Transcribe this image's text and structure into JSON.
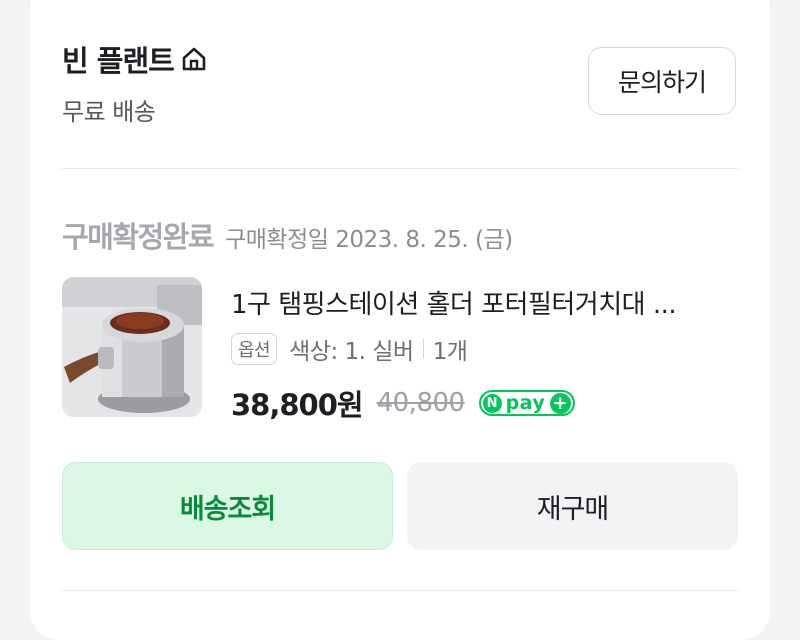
{
  "store": {
    "name": "빈 플랜트",
    "shipping": "무료 배송",
    "inquiry_label": "문의하기"
  },
  "order": {
    "status": "구매확정완료",
    "confirm_date": "구매확정일 2023. 8. 25. (금)"
  },
  "product": {
    "name": "1구 탬핑스테이션 홀더 포터필터거치대 ...",
    "option_chip": "옵션",
    "option_value": "색상: 1. 실버",
    "quantity": "1개",
    "price": "38,800원",
    "original_price": "40,800",
    "pay_badge": {
      "n": "N",
      "text": "pay",
      "plus": "+"
    }
  },
  "actions": {
    "track_label": "배송조회",
    "rebuy_label": "재구매"
  },
  "colors": {
    "accent_green": "#03c75a",
    "track_bg": "#dbf8e6",
    "track_text": "#0a8a3d"
  }
}
